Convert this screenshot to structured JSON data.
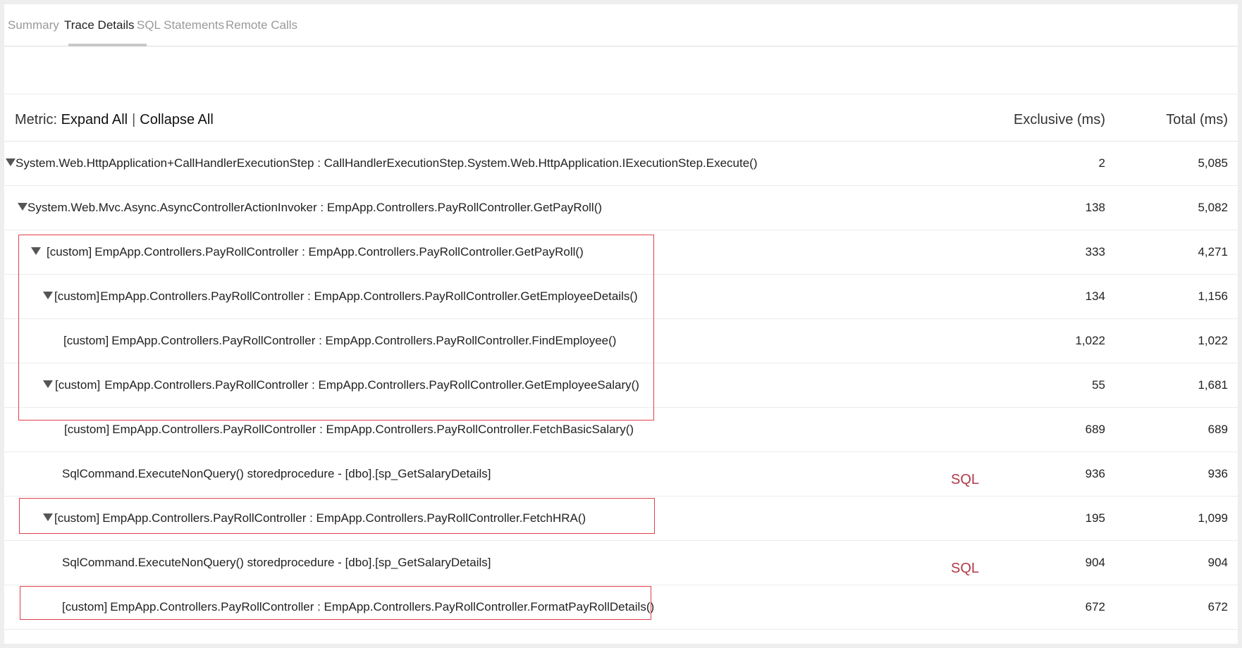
{
  "tabs": [
    {
      "label": "Summary",
      "active": false
    },
    {
      "label": "Trace Details",
      "active": true
    },
    {
      "label": "SQL Statements",
      "active": false
    },
    {
      "label": "Remote Calls",
      "active": false
    }
  ],
  "header": {
    "metric_label": "Metric:",
    "expand_all": "Expand All",
    "pipe": "|",
    "collapse_all": "Collapse All",
    "exclusive_col": "Exclusive (ms)",
    "total_col": "Total (ms)"
  },
  "rows": [
    {
      "expandable": true,
      "tag": "",
      "method": "System.Web.HttpApplication+CallHandlerExecutionStep : CallHandlerExecutionStep.System.Web.HttpApplication.IExecutionStep.Execute()",
      "sql": "",
      "exclusive": "2",
      "total": "5,085"
    },
    {
      "expandable": true,
      "tag": "",
      "method": "System.Web.Mvc.Async.AsyncControllerActionInvoker : EmpApp.Controllers.PayRollController.GetPayRoll()",
      "sql": "",
      "exclusive": "138",
      "total": "5,082"
    },
    {
      "expandable": true,
      "tag": "[custom]",
      "method": "EmpApp.Controllers.PayRollController : EmpApp.Controllers.PayRollController.GetPayRoll()",
      "sql": "",
      "exclusive": "333",
      "total": "4,271"
    },
    {
      "expandable": true,
      "tag": "[custom]",
      "method": "EmpApp.Controllers.PayRollController : EmpApp.Controllers.PayRollController.GetEmployeeDetails()",
      "sql": "",
      "exclusive": "134",
      "total": "1,156"
    },
    {
      "expandable": false,
      "tag": "[custom]",
      "method": "EmpApp.Controllers.PayRollController : EmpApp.Controllers.PayRollController.FindEmployee()",
      "sql": "",
      "exclusive": "1,022",
      "total": "1,022"
    },
    {
      "expandable": true,
      "tag": "[custom]",
      "method": "EmpApp.Controllers.PayRollController : EmpApp.Controllers.PayRollController.GetEmployeeSalary()",
      "sql": "",
      "exclusive": "55",
      "total": "1,681"
    },
    {
      "expandable": false,
      "tag": "[custom]",
      "method": "EmpApp.Controllers.PayRollController : EmpApp.Controllers.PayRollController.FetchBasicSalary()",
      "sql": "",
      "exclusive": "689",
      "total": "689"
    },
    {
      "expandable": false,
      "tag": "",
      "method": "SqlCommand.ExecuteNonQuery() storedprocedure - [dbo].[sp_GetSalaryDetails]",
      "sql": "SQL",
      "exclusive": "936",
      "total": "936"
    },
    {
      "expandable": true,
      "tag": "[custom]",
      "method": "EmpApp.Controllers.PayRollController : EmpApp.Controllers.PayRollController.FetchHRA()",
      "sql": "",
      "exclusive": "195",
      "total": "1,099"
    },
    {
      "expandable": false,
      "tag": "",
      "method": "SqlCommand.ExecuteNonQuery() storedprocedure - [dbo].[sp_GetSalaryDetails]",
      "sql": "SQL",
      "exclusive": "904",
      "total": "904"
    },
    {
      "expandable": false,
      "tag": "[custom]",
      "method": "EmpApp.Controllers.PayRollController : EmpApp.Controllers.PayRollController.FormatPayRollDetails()",
      "sql": "",
      "exclusive": "672",
      "total": "672"
    }
  ],
  "colors": {
    "highlight_border": "#e0404a",
    "sql_link": "#b03a48",
    "inactive_tab": "#9a9a9a"
  },
  "icons": {
    "expand_toggle": "triangle-down-icon"
  }
}
